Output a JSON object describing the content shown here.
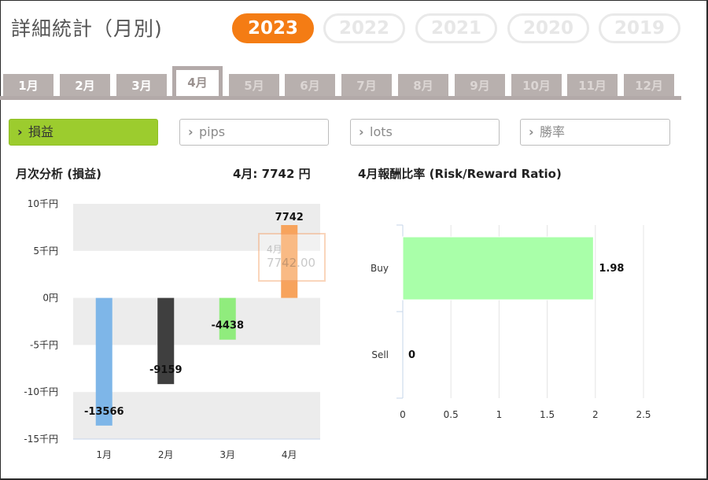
{
  "header": {
    "title": "詳細統計（月別)",
    "years": [
      {
        "label": "2023",
        "active": true
      },
      {
        "label": "2022",
        "active": false
      },
      {
        "label": "2021",
        "active": false
      },
      {
        "label": "2020",
        "active": false
      },
      {
        "label": "2019",
        "active": false
      }
    ]
  },
  "months": [
    {
      "label": "1月",
      "state": "enabled"
    },
    {
      "label": "2月",
      "state": "enabled"
    },
    {
      "label": "3月",
      "state": "enabled"
    },
    {
      "label": "4月",
      "state": "active"
    },
    {
      "label": "5月",
      "state": "disabled"
    },
    {
      "label": "6月",
      "state": "disabled"
    },
    {
      "label": "7月",
      "state": "disabled"
    },
    {
      "label": "8月",
      "state": "disabled"
    },
    {
      "label": "9月",
      "state": "disabled"
    },
    {
      "label": "10月",
      "state": "disabled"
    },
    {
      "label": "11月",
      "state": "disabled"
    },
    {
      "label": "12月",
      "state": "disabled"
    }
  ],
  "metrics": [
    {
      "label": "損益",
      "active": true
    },
    {
      "label": "pips",
      "active": false
    },
    {
      "label": "lots",
      "active": false
    },
    {
      "label": "勝率",
      "active": false
    }
  ],
  "left_section": {
    "title": "月次分析 (損益)",
    "summary": "4月:  7742 円"
  },
  "right_section": {
    "title": "4月報酬比率 (Risk/Reward Ratio)"
  },
  "tooltip": {
    "month": "4月",
    "value": "7742.00"
  },
  "colors": {
    "accent_orange": "#f47c14",
    "metric_active": "#9ccc2e",
    "tab_gray": "#b8b0ae"
  },
  "chart_data": [
    {
      "type": "bar",
      "title": "",
      "categories": [
        "1月",
        "2月",
        "3月",
        "4月"
      ],
      "values": [
        -13566,
        -9159,
        -4438,
        7742
      ],
      "value_labels": [
        "-13566",
        "-9159",
        "-4438",
        "7742"
      ],
      "colors": [
        "#7eb6e8",
        "#3f3f3f",
        "#90ec7d",
        "#f7a35c"
      ],
      "ylim": [
        -15000,
        10000
      ],
      "yticks": [
        10000,
        5000,
        0,
        -5000,
        -10000,
        -15000
      ],
      "ytick_labels": [
        "10千円",
        "5千円",
        "0円",
        "-5千円",
        "-10千円",
        "-15千円"
      ],
      "grid": "alternating bands",
      "xlabel": "",
      "ylabel": ""
    },
    {
      "type": "bar",
      "orientation": "horizontal",
      "title": "",
      "categories": [
        "Buy",
        "Sell"
      ],
      "values": [
        1.98,
        0
      ],
      "value_labels": [
        "1.98",
        "0"
      ],
      "colors": [
        "#a9ffa9",
        "#a9ffa9"
      ],
      "xlim": [
        0,
        2.5
      ],
      "xticks": [
        0,
        0.5,
        1,
        1.5,
        2,
        2.5
      ],
      "xtick_labels": [
        "0",
        "0.5",
        "1",
        "1.5",
        "2",
        "2.5"
      ],
      "grid": true,
      "xlabel": "",
      "ylabel": ""
    }
  ]
}
